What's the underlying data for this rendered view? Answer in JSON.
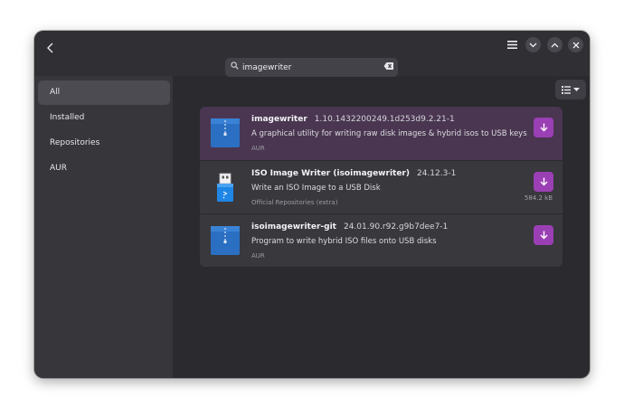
{
  "window": {
    "back_icon": "chevron-left-icon",
    "menu_icon": "hamburger-menu-icon",
    "minimize_icon": "chevron-down-icon",
    "maximize_icon": "chevron-up-icon",
    "close_icon": "close-icon"
  },
  "search": {
    "value": "imagewriter",
    "icon": "search-icon",
    "clear_icon": "backspace-clear-icon"
  },
  "sidebar": {
    "items": [
      {
        "label": "All",
        "active": true
      },
      {
        "label": "Installed",
        "active": false
      },
      {
        "label": "Repositories",
        "active": false
      },
      {
        "label": "AUR",
        "active": false
      }
    ]
  },
  "view_toggle": {
    "icon": "list-view-icon",
    "dropdown_icon": "dropdown-arrow-icon"
  },
  "results": [
    {
      "name": "imagewriter",
      "version": "1.10.1432200249.1d253d9.2.21-1",
      "description": "A graphical utility for writing raw disk images & hybrid isos to USB keys",
      "source": "AUR",
      "size": "",
      "icon": "archive-package-icon",
      "selected": true
    },
    {
      "name": "ISO Image Writer (isoimagewriter)",
      "version": "24.12.3-1",
      "description": "Write an ISO Image to a USB Disk",
      "source": "Official Repositories (extra)",
      "size": "584.2 kB",
      "icon": "usb-drive-icon",
      "selected": false
    },
    {
      "name": "isoimagewriter-git",
      "version": "24.01.90.r92.g9b7dee7-1",
      "description": "Program to write hybrid ISO files onto USB disks",
      "source": "AUR",
      "size": "",
      "icon": "archive-package-icon",
      "selected": false
    }
  ],
  "colors": {
    "window_bg": "#2a2a2f",
    "sidebar_bg": "#36363b",
    "accent": "#9b3fb4",
    "selected_row": "#4a3651"
  }
}
